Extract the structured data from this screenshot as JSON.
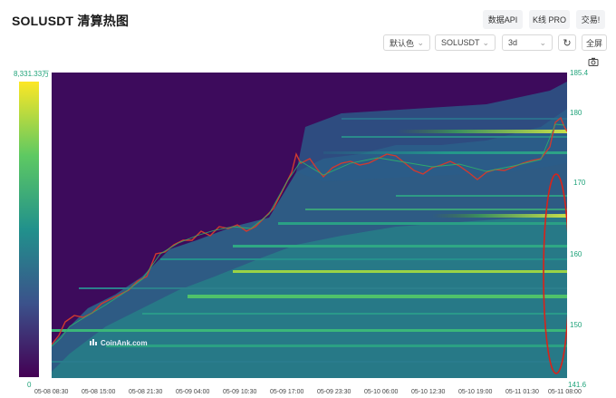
{
  "title": "SOLUSDT 清算热图",
  "header_buttons": {
    "data_api": "数据API",
    "kline_pro": "K线 PRO",
    "trade": "交易!"
  },
  "controls": {
    "color_scheme": "默认色",
    "symbol": "SOLUSDT",
    "period": "3d",
    "refresh_icon": "refresh-icon",
    "fullscreen": "全屏",
    "camera_icon": "camera-icon"
  },
  "color_scale": {
    "max_label": "8,331.33万",
    "min_label": "0",
    "colors": [
      "#440154",
      "#3b528b",
      "#21918c",
      "#5ec962",
      "#fde725"
    ]
  },
  "watermark": "CoinAnk.com",
  "chart_data": {
    "type": "heatmap",
    "y_range": [
      141.6,
      185.4
    ],
    "y_ticks": [
      "185.4",
      "180",
      "170",
      "160",
      "150",
      "141.6"
    ],
    "x_ticks": [
      "05-08 08:30",
      "05-08 15:00",
      "05-08 21:30",
      "05-09 04:00",
      "05-09 10:30",
      "05-09 17:00",
      "05-09 23:30",
      "05-10 06:00",
      "05-10 12:30",
      "05-10 19:00",
      "05-11 01:30",
      "05-11 08:00"
    ],
    "price_close_approx": [
      146,
      147,
      149,
      151,
      154,
      160,
      162,
      164,
      169,
      175,
      170,
      173,
      174,
      172,
      172,
      173,
      179
    ],
    "annotation": "red ellipse on right side highlighting price range ~141.6–173"
  }
}
